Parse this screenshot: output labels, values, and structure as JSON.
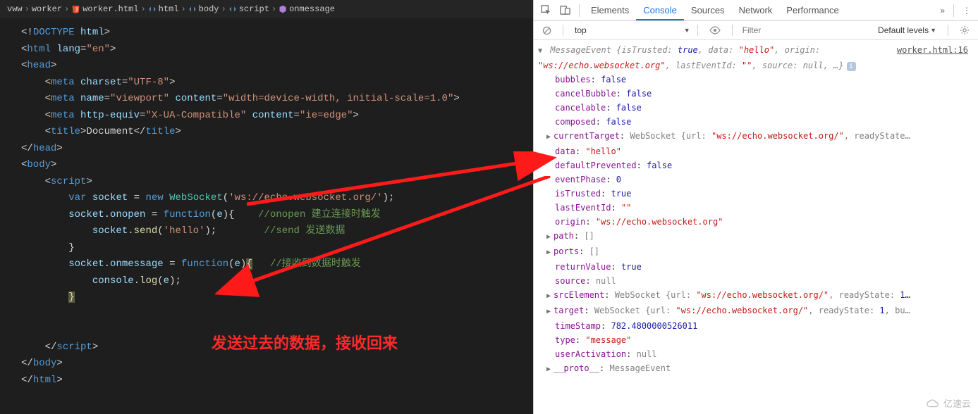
{
  "breadcrumbs": {
    "root": "vww",
    "folder": "worker",
    "file": "worker.html",
    "path1": "html",
    "path2": "body",
    "path3": "script",
    "path4": "onmessage"
  },
  "code": {
    "doctype_open": "<!",
    "doctype": "DOCTYPE",
    "html_kw": " html",
    "html_open": "html",
    "lang_attr": "lang",
    "lang_val": "\"en\"",
    "head": "head",
    "meta": "meta",
    "charset_attr": "charset",
    "charset_val": "\"UTF-8\"",
    "name_attr": "name",
    "viewport_val": "\"viewport\"",
    "content_attr": "content",
    "content_vp": "\"width=device-width, initial-scale=1.0\"",
    "httpequiv_attr": "http-equiv",
    "httpequiv_val": "\"X-UA-Compatible\"",
    "ieedge_val": "\"ie=edge\"",
    "title": "title",
    "title_text": "Document",
    "body": "body",
    "script": "script",
    "var_kw": "var",
    "socket": "socket",
    "eq": " = ",
    "new_kw": "new",
    "ws_type": "WebSocket",
    "ws_url": "'ws://echo.websocket.org/'",
    "onopen": "onopen",
    "fn_kw": "function",
    "param_e": "e",
    "cmt_onopen": "//onopen 建立连接时触发",
    "send_fn": "send",
    "hello": "'hello'",
    "cmt_send": "//send 发送数据",
    "onmessage": "onmessage",
    "cmt_onmsg": "//接收到数据时触发",
    "console": "console",
    "log_fn": "log"
  },
  "annotation": "发送过去的数据，接收回来",
  "devtools": {
    "tabs": {
      "elements": "Elements",
      "console": "Console",
      "sources": "Sources",
      "network": "Network",
      "performance": "Performance"
    },
    "toolbar": {
      "context": "top",
      "filter_placeholder": "Filter",
      "levels": "Default levels"
    },
    "src_link": "worker.html:16",
    "head": {
      "cls": "MessageEvent",
      "isTrusted_k": "isTrusted",
      "isTrusted_v": "true",
      "data_k": "data",
      "data_v": "\"hello\"",
      "origin_k": "origin",
      "origin_v": "\"ws://echo.websocket.org\"",
      "lastEventId_k": "lastEventId",
      "lastEventId_v": "\"\"",
      "source_k": "source",
      "source_v": "null"
    },
    "props": {
      "bubbles_k": "bubbles",
      "bubbles_v": "false",
      "cancelBubble_k": "cancelBubble",
      "cancelBubble_v": "false",
      "cancelable_k": "cancelable",
      "cancelable_v": "false",
      "composed_k": "composed",
      "composed_v": "false",
      "currentTarget_k": "currentTarget",
      "currentTarget_t": "WebSocket",
      "currentTarget_url": "\"ws://echo.websocket.org/\"",
      "currentTarget_rs": "readyState…",
      "data_k": "data",
      "data_v": "\"hello\"",
      "defaultPrevented_k": "defaultPrevented",
      "defaultPrevented_v": "false",
      "eventPhase_k": "eventPhase",
      "eventPhase_v": "0",
      "isTrusted_k": "isTrusted",
      "isTrusted_v": "true",
      "lastEventId_k": "lastEventId",
      "lastEventId_v": "\"\"",
      "origin_k": "origin",
      "origin_v": "\"ws://echo.websocket.org\"",
      "path_k": "path",
      "path_v": "[]",
      "ports_k": "ports",
      "ports_v": "[]",
      "returnValue_k": "returnValue",
      "returnValue_v": "true",
      "source_k": "source",
      "source_v": "null",
      "srcElement_k": "srcElement",
      "srcElement_t": "WebSocket",
      "srcElement_url": "\"ws://echo.websocket.org/\"",
      "srcElement_rs_k": "readyState",
      "srcElement_rs_v": "1…",
      "target_k": "target",
      "target_t": "WebSocket",
      "target_url": "\"ws://echo.websocket.org/\"",
      "target_rs_k": "readyState",
      "target_rs_v": "1",
      "target_more": "bu…",
      "timeStamp_k": "timeStamp",
      "timeStamp_v": "782.4800000526011",
      "type_k": "type",
      "type_v": "\"message\"",
      "userActivation_k": "userActivation",
      "userActivation_v": "null",
      "proto_k": "__proto__",
      "proto_v": "MessageEvent"
    }
  },
  "watermark": "亿速云"
}
